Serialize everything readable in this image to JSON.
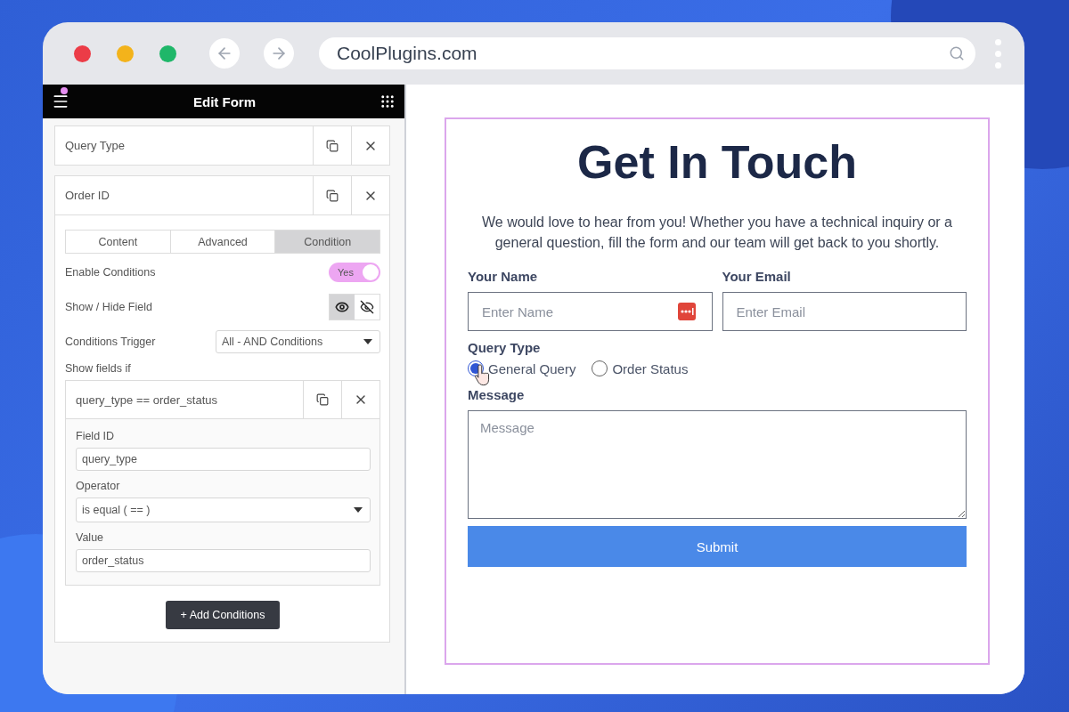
{
  "browser": {
    "url": "CoolPlugins.com"
  },
  "editor": {
    "title": "Edit Form",
    "has_notification": true,
    "fields": [
      {
        "label": "Query Type",
        "expanded": false
      },
      {
        "label": "Order ID",
        "expanded": true
      }
    ],
    "tabs": [
      {
        "label": "Content",
        "selected": false
      },
      {
        "label": "Advanced",
        "selected": false
      },
      {
        "label": "Condition",
        "selected": true
      }
    ],
    "enable_conditions": {
      "label": "Enable Conditions",
      "toggle_text": "Yes",
      "on": true
    },
    "show_hide": {
      "label": "Show / Hide Field",
      "options": [
        {
          "kind": "show",
          "selected": true
        },
        {
          "kind": "hide",
          "selected": false
        }
      ]
    },
    "conditions_trigger": {
      "label": "Conditions Trigger",
      "value": "All - AND Conditions"
    },
    "show_fields_label": "Show fields if",
    "condition": {
      "title": "query_type == order_status",
      "field_id_label": "Field ID",
      "field_id": "query_type",
      "operator_label": "Operator",
      "operator": "is equal ( == )",
      "value_label": "Value",
      "value": "order_status"
    },
    "add_button": "+ Add Conditions"
  },
  "form": {
    "title": "Get In Touch",
    "description": "We would love to hear from you! Whether you have a technical inquiry or a general question, fill the form and our team will get back to you shortly.",
    "name": {
      "label": "Your Name",
      "placeholder": "Enter Name"
    },
    "email": {
      "label": "Your Email",
      "placeholder": "Enter Email"
    },
    "query_type": {
      "label": "Query Type",
      "options": [
        {
          "label": "General Query",
          "selected": true
        },
        {
          "label": "Order Status",
          "selected": false
        }
      ]
    },
    "message": {
      "label": "Message",
      "placeholder": "Message"
    },
    "submit": "Submit"
  }
}
